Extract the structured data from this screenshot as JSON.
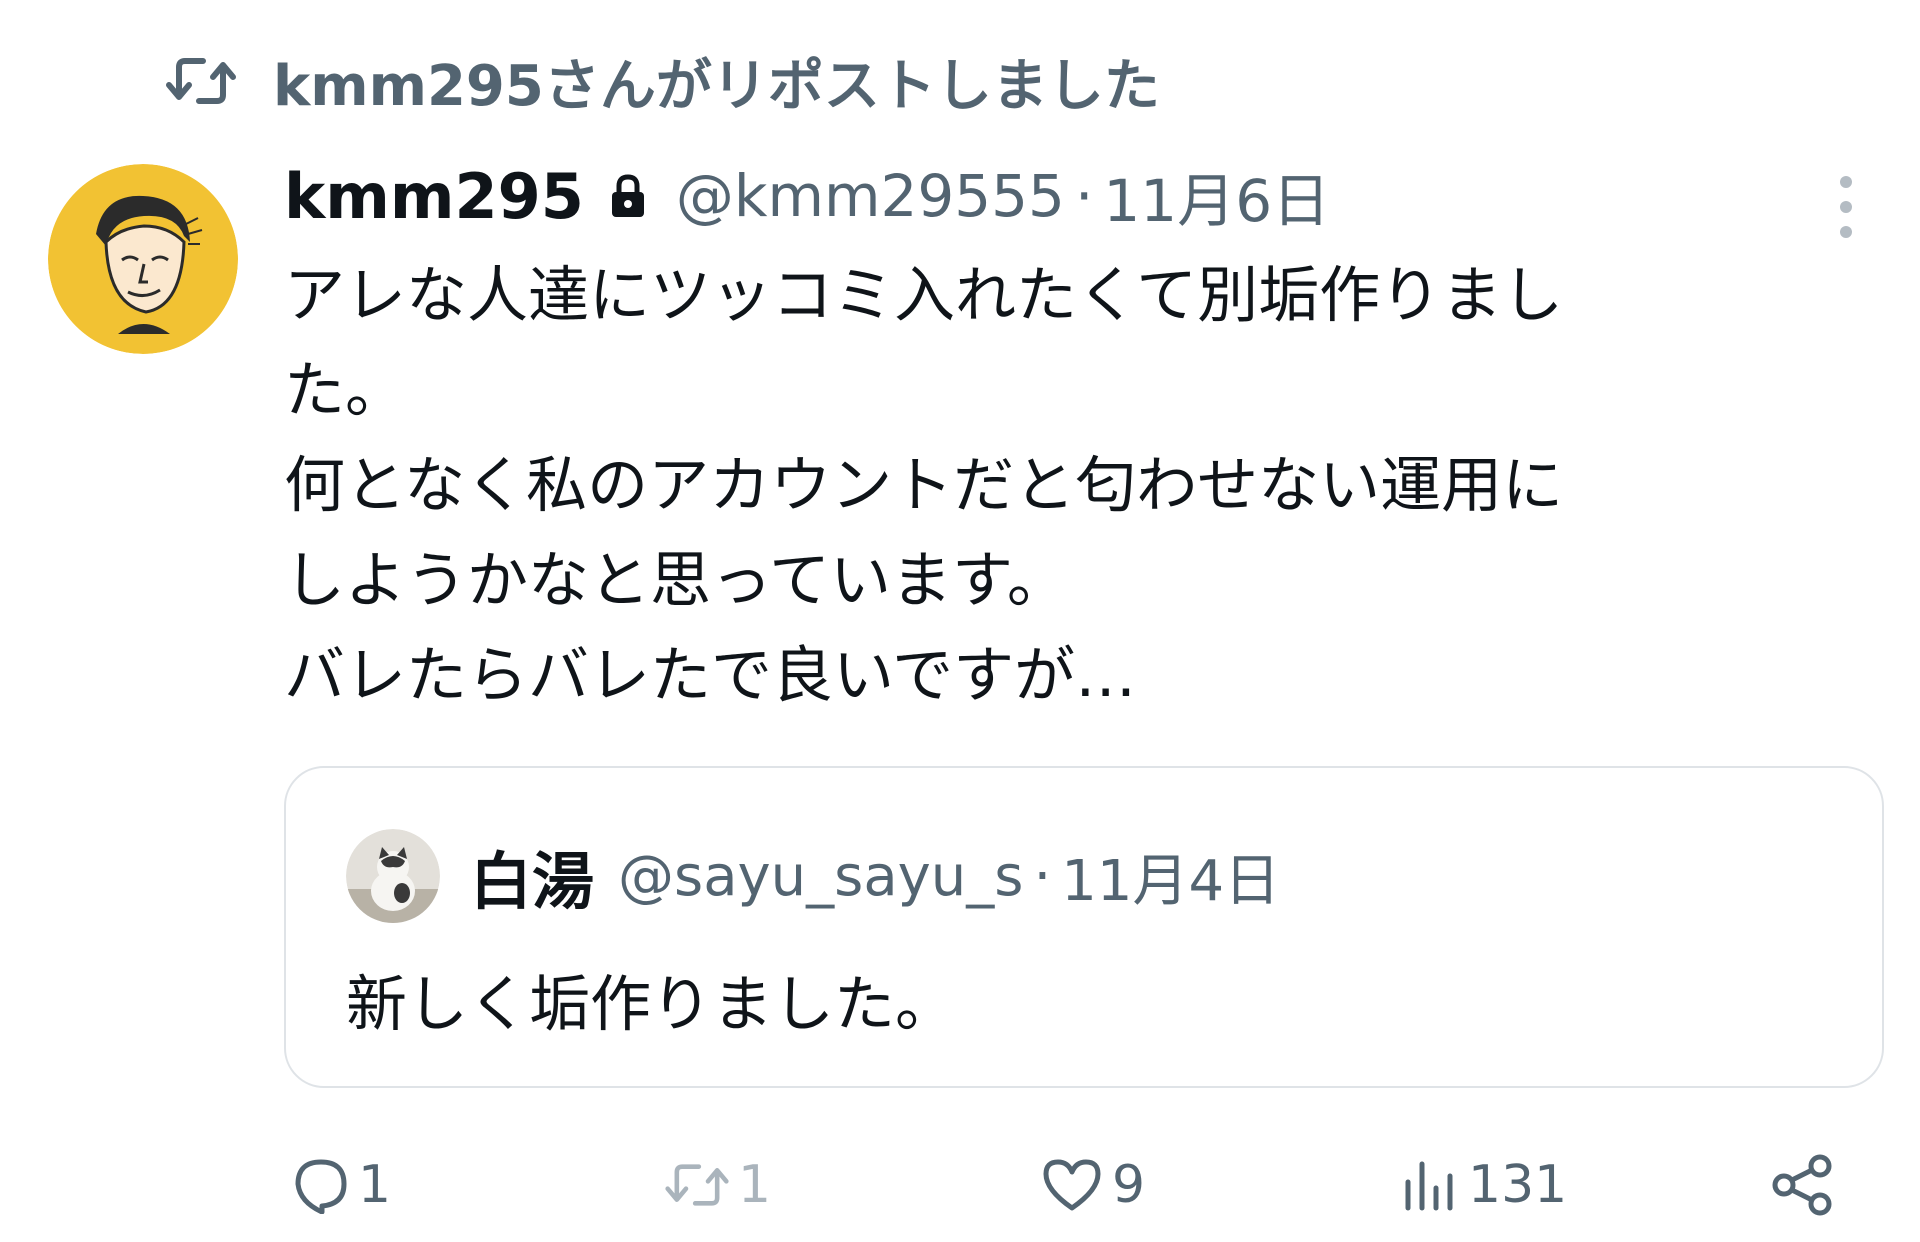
{
  "repost_banner": {
    "text": "kmm295さんがリポストしました",
    "icon": "repost-icon"
  },
  "tweet": {
    "avatar_icon": "avatar-illustration",
    "display_name": "kmm295",
    "protected_icon": "lock-icon",
    "handle": "@kmm29555",
    "separator": "·",
    "date": "11月6日",
    "more_icon": "more-vertical-icon",
    "text_lines": [
      "アレな人達にツッコミ入れたくて別垢作りまし",
      "た。",
      "何となく私のアカウントだと匂わせない運用に",
      "しようかなと思っています。",
      "バレたらバレたで良いですが…"
    ]
  },
  "quoted_tweet": {
    "avatar_icon": "cat-avatar",
    "display_name": "白湯",
    "handle": "@sayu_sayu_s",
    "separator": "·",
    "date": "11月4日",
    "text": "新しく垢作りました。"
  },
  "actions": {
    "reply": {
      "icon": "reply-icon",
      "count": "1"
    },
    "repost": {
      "icon": "repost-icon",
      "count": "1"
    },
    "like": {
      "icon": "heart-icon",
      "count": "9"
    },
    "views": {
      "icon": "views-icon",
      "count": "131"
    },
    "share": {
      "icon": "share-icon"
    }
  },
  "colors": {
    "text_primary": "#0f1419",
    "text_secondary": "#536471",
    "border": "#dfe3e7",
    "avatar_background": "#f2c233"
  }
}
